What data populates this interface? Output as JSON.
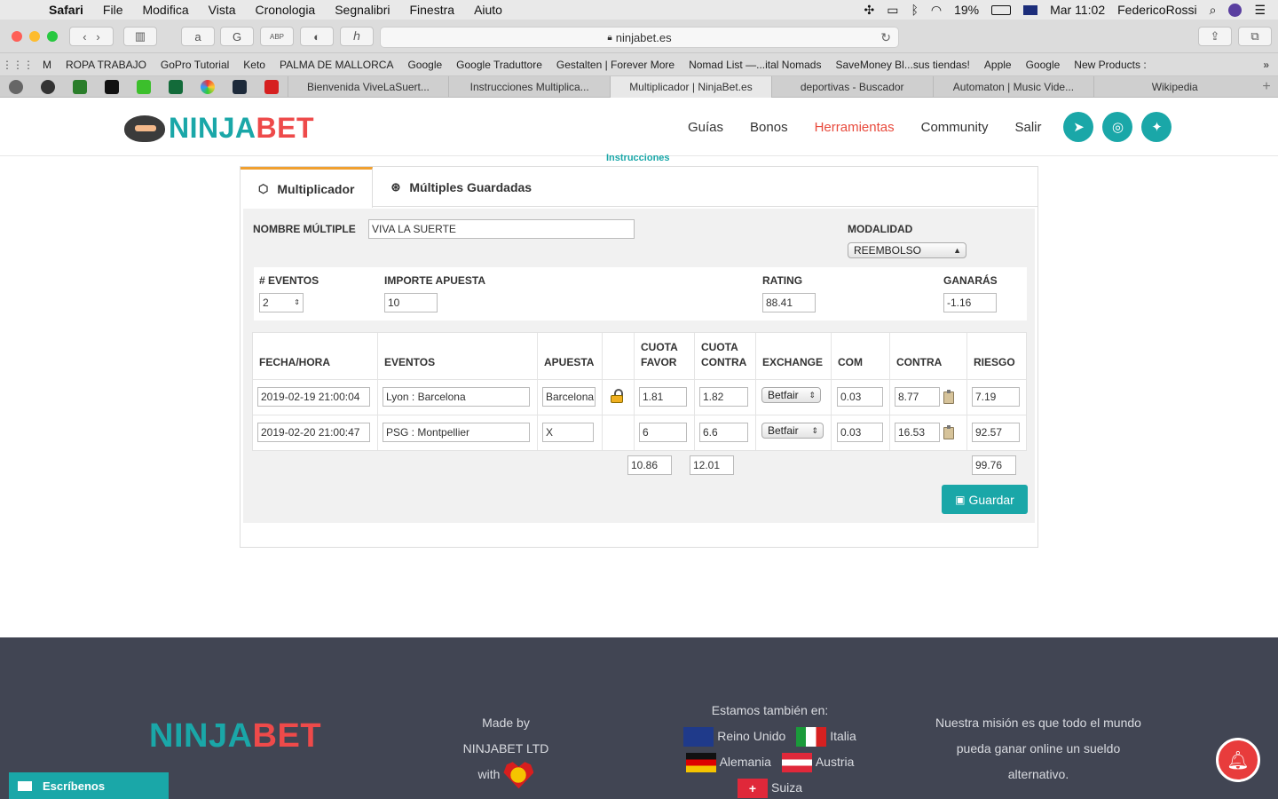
{
  "menubar": {
    "app": "Safari",
    "items": [
      "File",
      "Modifica",
      "Vista",
      "Cronologia",
      "Segnalibri",
      "Finestra",
      "Aiuto"
    ],
    "battery": "19%",
    "clock": "Mar 11:02",
    "user": "FedericoRossi"
  },
  "address": {
    "url": "ninjabet.es"
  },
  "bookmarks": [
    "M",
    "ROPA TRABAJO",
    "GoPro Tutorial",
    "Keto",
    "PALMA DE MALLORCA",
    "Google",
    "Google Traduttore",
    "Gestalten | Forever More",
    "Nomad List —...ital Nomads",
    "SaveMoney Bl...sus tiendas!",
    "Apple",
    "Google",
    "New Products :"
  ],
  "tabs": [
    "Bienvenida ViveLaSuert...",
    "Instrucciones Multiplica...",
    "Multiplicador | NinjaBet.es",
    "deportivas - Buscador",
    "Automaton | Music Vide...",
    "Wikipedia"
  ],
  "site": {
    "logo_a": "NINJA",
    "logo_b": "BET",
    "nav": [
      "Guías",
      "Bonos",
      "Herramientas",
      "Community",
      "Salir"
    ],
    "instructions": "Instrucciones"
  },
  "panel": {
    "tab1": "Multiplicador",
    "tab2": "Múltiples Guardadas",
    "name_label": "NOMBRE MÚLTIPLE",
    "name_value": "VIVA LA SUERTE",
    "modalidad_label": "MODALIDAD",
    "modalidad_value": "REEMBOLSO",
    "eventos_label": "# EVENTOS",
    "eventos_value": "2",
    "importe_label": "IMPORTE APUESTA",
    "importe_value": "10",
    "rating_label": "RATING",
    "rating_value": "88.41",
    "ganaras_label": "GANARÁS",
    "ganaras_value": "-1.16",
    "headers": {
      "fecha": "FECHA/HORA",
      "eventos": "EVENTOS",
      "apuesta": "APUESTA",
      "cuota_favor_1": "CUOTA",
      "cuota_favor_2": "FAVOR",
      "cuota_contra_1": "CUOTA",
      "cuota_contra_2": "CONTRA",
      "exchange": "EXCHANGE",
      "com": "COM",
      "contra": "CONTRA",
      "riesgo": "RIESGO"
    },
    "rows": [
      {
        "fecha": "2019-02-19 21:00:04",
        "evento": "Lyon : Barcelona",
        "apuesta": "Barcelona",
        "favor": "1.81",
        "contra_cuota": "1.82",
        "exchange": "Betfair",
        "com": "0.03",
        "contra": "8.77",
        "riesgo": "7.19"
      },
      {
        "fecha": "2019-02-20 21:00:47",
        "evento": "PSG : Montpellier",
        "apuesta": "X",
        "favor": "6",
        "contra_cuota": "6.6",
        "exchange": "Betfair",
        "com": "0.03",
        "contra": "16.53",
        "riesgo": "92.57"
      }
    ],
    "totals": {
      "favor": "10.86",
      "contra": "12.01",
      "riesgo": "99.76"
    },
    "save": "Guardar"
  },
  "footer": {
    "logo_a": "NINJA",
    "logo_b": "BET",
    "made_1": "Made by",
    "made_2": "NINJABET LTD",
    "made_3": "with",
    "also": "Estamos también en:",
    "countries": [
      "Reino Unido",
      "Italia",
      "Alemania",
      "Austria",
      "Suiza"
    ],
    "mission_1": "Nuestra misión es que todo el mundo",
    "mission_2": "pueda ganar online un sueldo",
    "mission_3": "alternativo.",
    "write": "Escríbenos"
  }
}
